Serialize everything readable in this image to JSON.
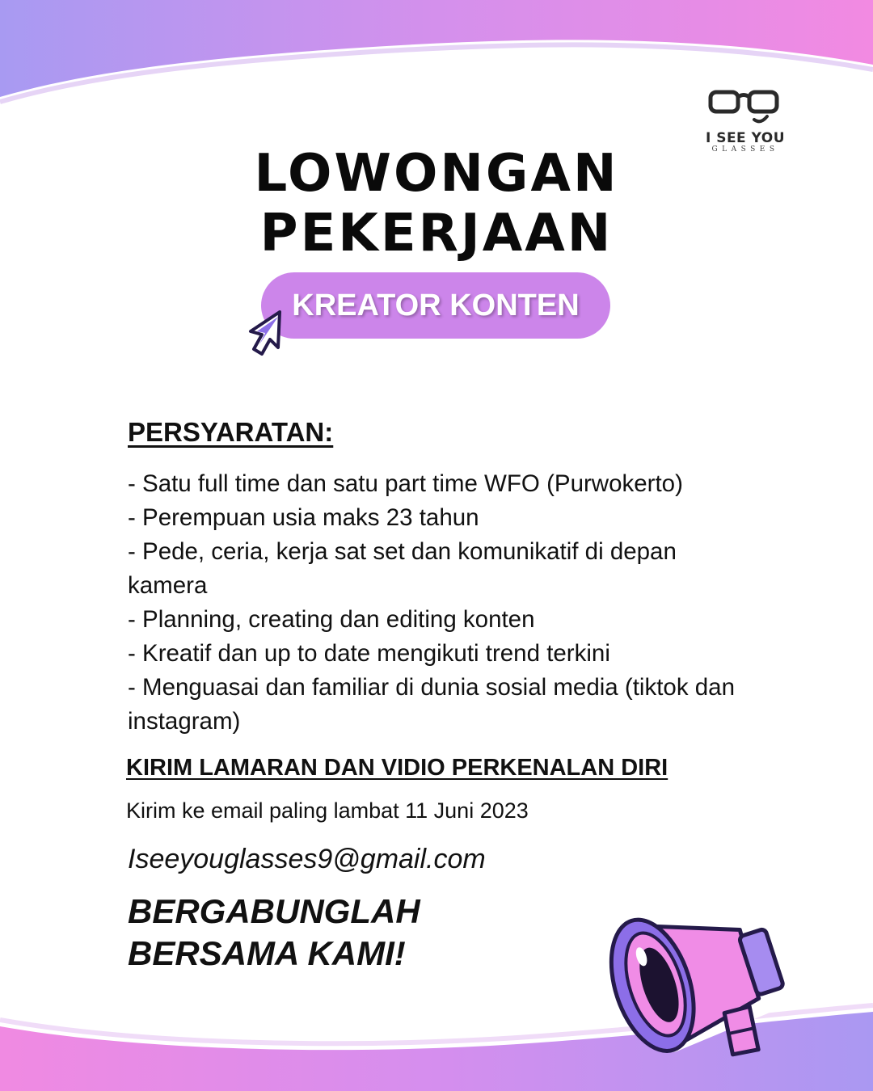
{
  "brand": {
    "name": "I SEE YOU",
    "sub": "GLASSES",
    "icon": "glasses-icon"
  },
  "title": {
    "line1": "LOWONGAN",
    "line2": "PEKERJAAN"
  },
  "position": {
    "label": "KREATOR KONTEN",
    "icon": "cursor-arrow-icon"
  },
  "requirements": {
    "heading": "PERSYARATAN:",
    "items": [
      "- Satu full time dan satu part time WFO (Purwokerto)",
      "- Perempuan usia maks 23 tahun",
      "- Pede, ceria, kerja sat set dan komunikatif di depan kamera",
      "- Planning, creating dan editing konten",
      "- Kreatif dan up to date mengikuti trend terkini",
      "- Menguasai dan familiar di dunia sosial media (tiktok dan instagram)"
    ]
  },
  "application": {
    "heading": "KIRIM LAMARAN DAN VIDIO PERKENALAN DIRI",
    "note": "Kirim ke email paling lambat 11 Juni 2023",
    "email": "Iseeyouglasses9@gmail.com"
  },
  "cta": {
    "line1": "BERGABUNGLAH",
    "line2": "BERSAMA KAMI!"
  },
  "decor": {
    "megaphone_icon": "megaphone-icon"
  },
  "colors": {
    "accent_pink": "#cc85ea",
    "accent_purple": "#a68cf0",
    "megaphone_pink": "#f08ce6",
    "outline_purple": "#5b3fc4"
  }
}
